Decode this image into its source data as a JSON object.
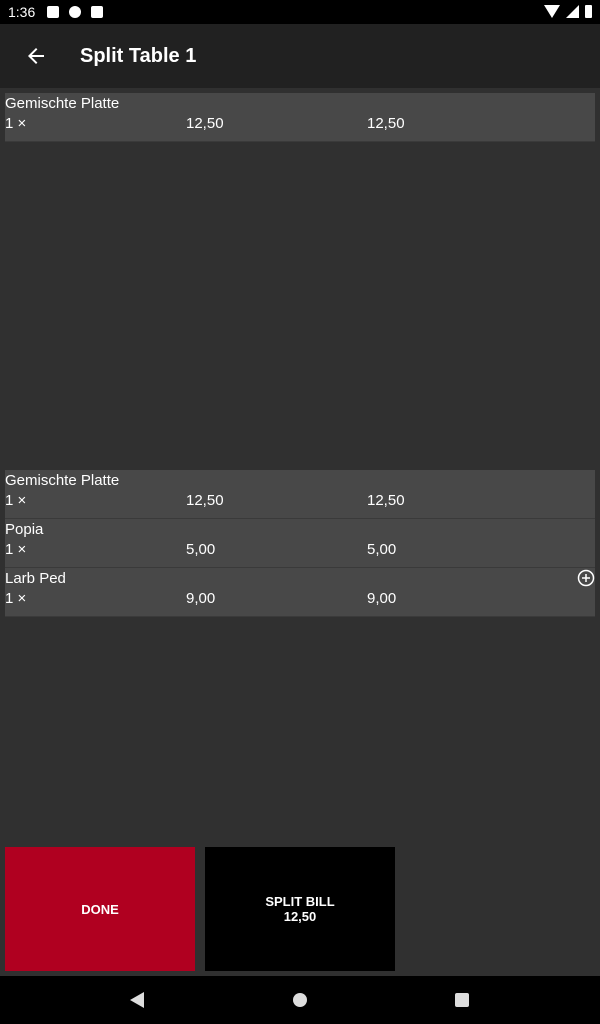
{
  "status_bar": {
    "time": "1:36"
  },
  "app_bar": {
    "title": "Split Table 1",
    "back_icon": "arrow-left-icon"
  },
  "top_items": [
    {
      "name": "Gemischte Platte",
      "qty": "1 ×",
      "price": "12,50",
      "total": "12,50"
    }
  ],
  "bottom_items": [
    {
      "name": "Gemischte Platte",
      "qty": "1 ×",
      "price": "12,50",
      "total": "12,50"
    },
    {
      "name": "Popia",
      "qty": "1 ×",
      "price": "5,00",
      "total": "5,00"
    },
    {
      "name": "Larb Ped",
      "qty": "1 ×",
      "price": "9,00",
      "total": "9,00"
    }
  ],
  "buttons": {
    "done_label": "DONE",
    "split_label": "SPLIT BILL",
    "split_amount": "12,50"
  },
  "colors": {
    "background": "#303030",
    "row": "#484848",
    "app_bar": "#212121",
    "done": "#b00020",
    "split": "#000000"
  }
}
